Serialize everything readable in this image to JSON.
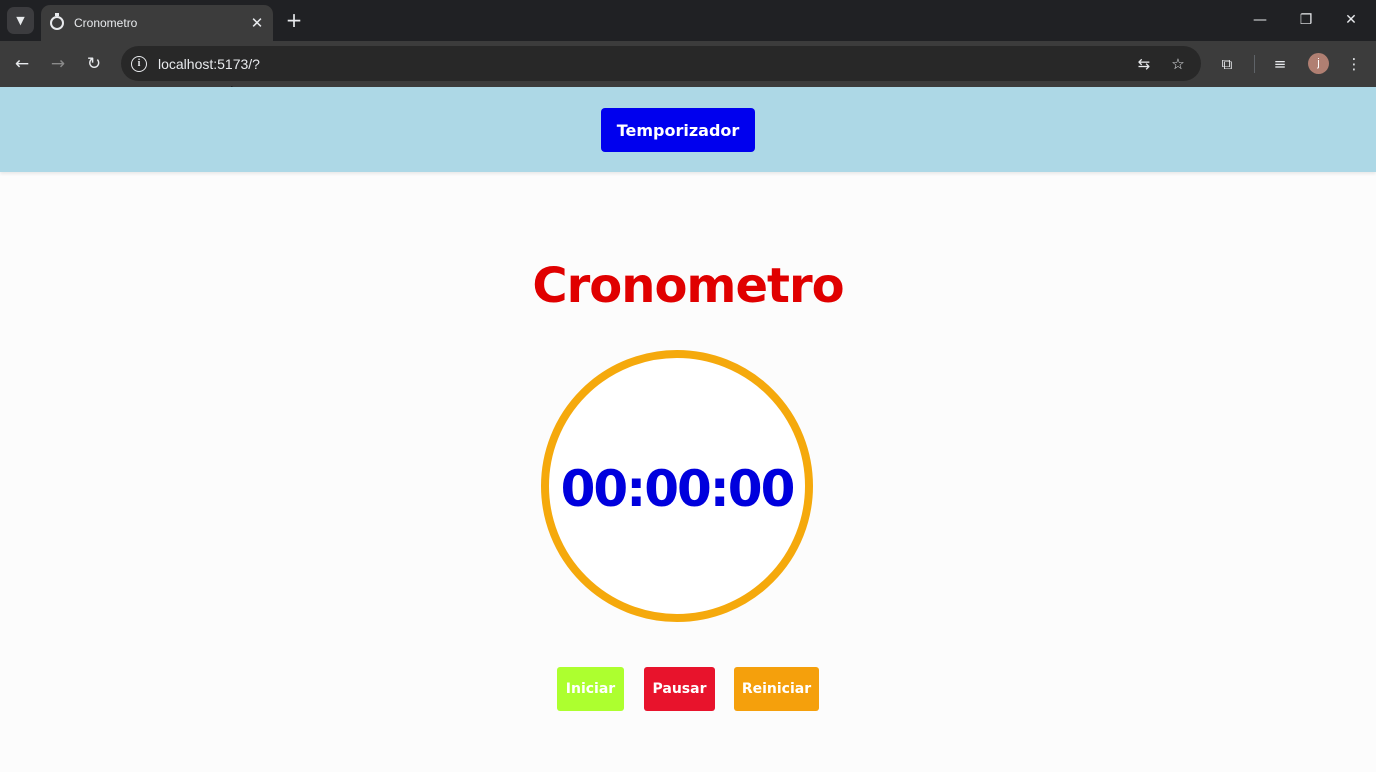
{
  "browser": {
    "tab_title": "Cronometro",
    "address": "localhost:5173/?",
    "icons": {
      "tab_search": "chevron-down-icon",
      "favicon": "stopwatch-icon",
      "tab_close": "close-icon",
      "new_tab": "plus-icon",
      "back": "arrow-left-icon",
      "forward": "arrow-right-icon",
      "reload": "reload-icon",
      "site_info": "info-icon",
      "translate": "translate-icon",
      "bookmark": "star-icon",
      "extensions": "puzzle-icon",
      "media": "media-queue-icon",
      "menu": "more-vert-icon"
    },
    "avatar_initial": "j"
  },
  "header": {
    "nav_button_label": "Temporizador"
  },
  "main": {
    "title": "Cronometro",
    "time": "00:00:00"
  },
  "controls": {
    "start_label": "Iniciar",
    "pause_label": "Pausar",
    "reset_label": "Reiniciar"
  },
  "colors": {
    "header_bg": "#add8e6",
    "nav_button_bg": "#0000ee",
    "title": "#e00000",
    "ring": "#f5a90c",
    "time": "#0000dd",
    "start": "#adff2f",
    "pause": "#e8132c",
    "reset": "#f5a00c"
  }
}
